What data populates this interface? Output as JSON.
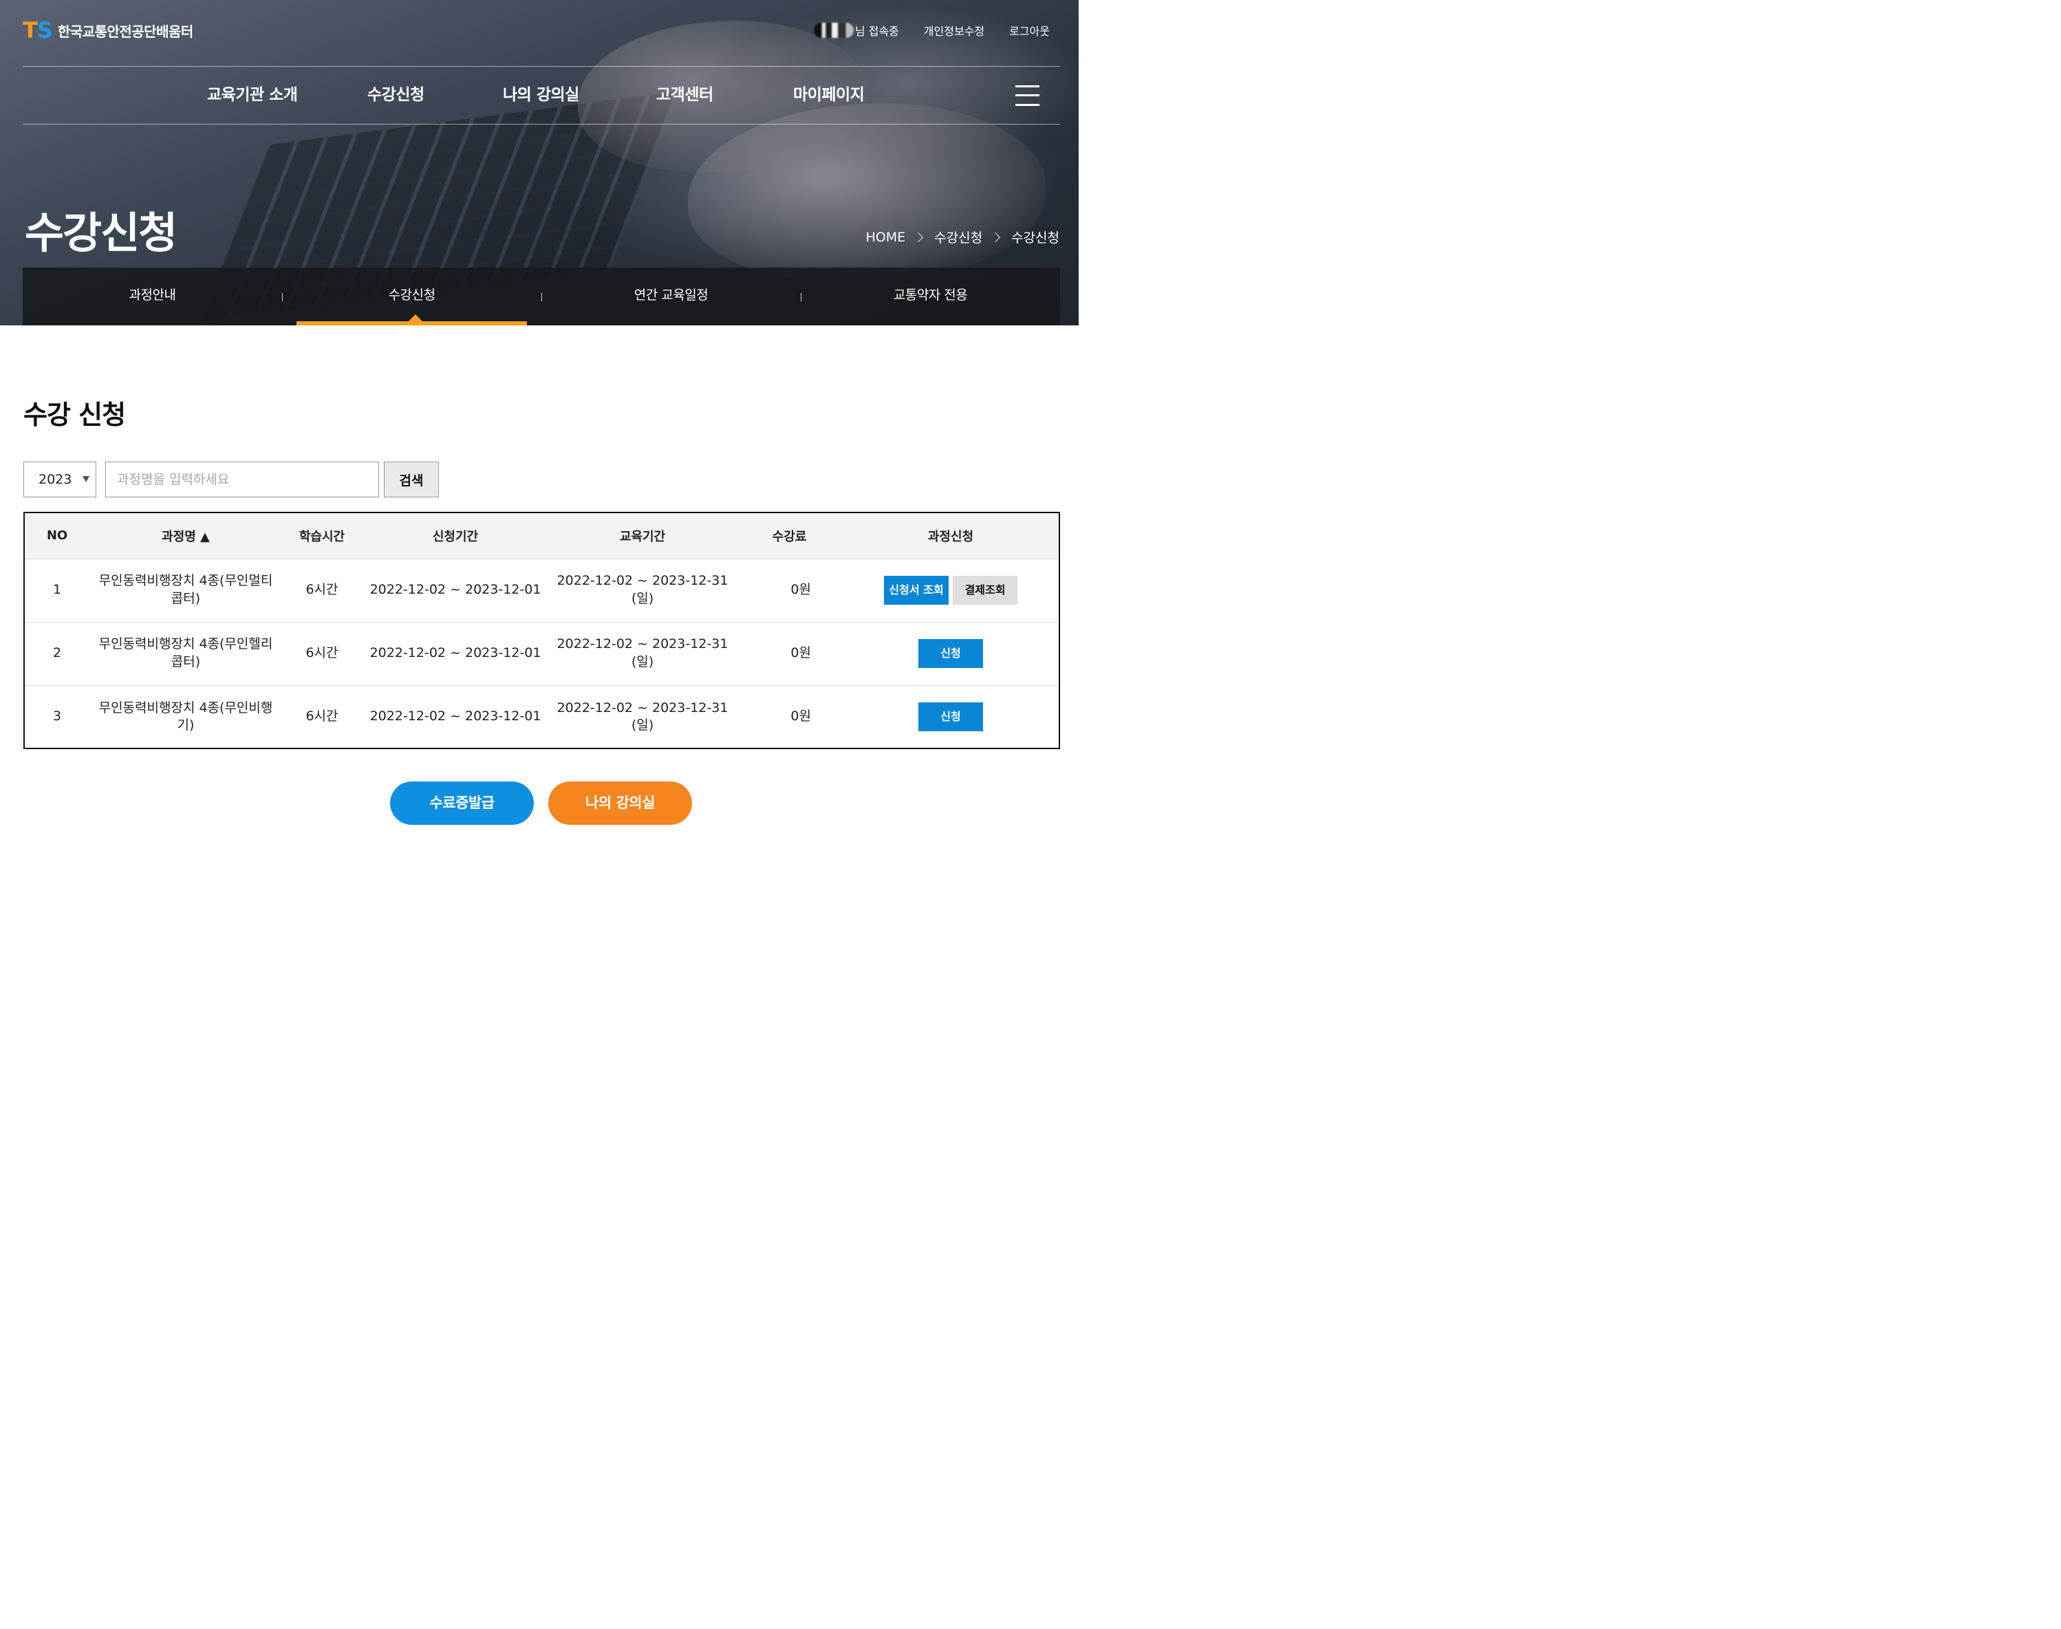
{
  "header": {
    "logo_mark_t": "T",
    "logo_mark_s": "S",
    "logo_text": "한국교통안전공단배움터",
    "user_status": "님 접속중",
    "edit_profile": "개인정보수정",
    "logout": "로그아웃"
  },
  "gnb": {
    "items": [
      "교육기관 소개",
      "수강신청",
      "나의 강의실",
      "고객센터",
      "마이페이지"
    ]
  },
  "hero": {
    "title": "수강신청",
    "breadcrumb": [
      "HOME",
      "수강신청",
      "수강신청"
    ]
  },
  "subnav": {
    "items": [
      "과정안내",
      "수강신청",
      "연간 교육일정",
      "교통약자 전용"
    ],
    "active": "수강신청"
  },
  "page": {
    "title": "수강 신청"
  },
  "filter": {
    "year": "2023",
    "search_placeholder": "과정명을 입력하세요",
    "search_button": "검색"
  },
  "table": {
    "headers": {
      "no": "NO",
      "course": "과정명 ▲",
      "hours": "학습시간",
      "apply_period": "신청기간",
      "edu_period": "교육기간",
      "fee": "수강료",
      "action": "과정신청"
    },
    "rows": [
      {
        "no": "1",
        "course_l1": "무인동력비행장치 4종(무인멀티",
        "course_l2": "콥터)",
        "hours": "6시간",
        "apply_period": "2022-12-02 ~ 2023-12-01",
        "edu_l1": "2022-12-02 ~ 2023-12-31",
        "edu_l2": "(일)",
        "fee": "0원",
        "btn1": "신청서 조회",
        "btn2": "결제조회"
      },
      {
        "no": "2",
        "course_l1": "무인동력비행장치 4종(무인헬리",
        "course_l2": "콥터)",
        "hours": "6시간",
        "apply_period": "2022-12-02 ~ 2023-12-01",
        "edu_l1": "2022-12-02 ~ 2023-12-31",
        "edu_l2": "(일)",
        "fee": "0원",
        "btn1": "신청"
      },
      {
        "no": "3",
        "course_l1": "무인동력비행장치 4종(무인비행",
        "course_l2": "기)",
        "hours": "6시간",
        "apply_period": "2022-12-02 ~ 2023-12-01",
        "edu_l1": "2022-12-02 ~ 2023-12-31",
        "edu_l2": "(일)",
        "fee": "0원",
        "btn1": "신청"
      }
    ]
  },
  "bottom": {
    "certificate_button": "수료증발급",
    "my_classroom_button": "나의 강의실"
  },
  "colors": {
    "brand_orange": "#f29a1f",
    "brand_blue": "#1e9be0",
    "button_blue": "#0a86d6",
    "pill_blue": "#0e8fe0",
    "pill_orange": "#f5851f",
    "active_bar": "#f5a020"
  },
  "icons": {
    "menu": "hamburger-icon",
    "breadcrumb_separator": "chevron-right-icon",
    "select_arrow": "caret-down-icon",
    "active_tab_marker": "caret-up-icon"
  }
}
